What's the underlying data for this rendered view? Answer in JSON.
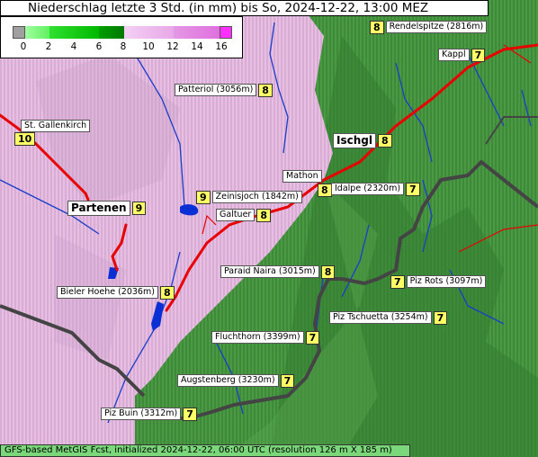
{
  "title": "Niederschlag letzte 3 Std. (in mm) bis So, 2024-12-22, 13:00 MEZ",
  "legend": {
    "ticks": [
      "0",
      "2",
      "4",
      "6",
      "8",
      "10",
      "12",
      "14",
      "16"
    ],
    "colors": [
      "#a0a0a0",
      "#80ff80",
      "#00e000",
      "#00b000",
      "#008000",
      "#f0c0f0",
      "#e8a0e8",
      "#e080e0",
      "#ff40ff"
    ]
  },
  "footer": "GFS-based MetGIS Fcst, initialized 2024-12-22, 06:00 UTC  (resolution 126 m X 185 m)",
  "places": [
    {
      "name": "Rendelspitze (2816m)",
      "value": "8",
      "order": "value-first"
    },
    {
      "name": "Kappl",
      "value": "7",
      "order": "name-first"
    },
    {
      "name": "Patteriol (3056m)",
      "value": "8",
      "order": "name-first"
    },
    {
      "name": "St. Gallenkirch",
      "value": "10",
      "order": "name-above"
    },
    {
      "name": "Ischgl",
      "value": "8",
      "order": "name-first",
      "big": true
    },
    {
      "name": "Mathon",
      "value": "8",
      "order": "name-above"
    },
    {
      "name": "Idalpe (2320m)",
      "value": "7",
      "order": "name-first"
    },
    {
      "name": "Zeinisjoch (1842m)",
      "value": "9",
      "order": "value-first"
    },
    {
      "name": "Partenen",
      "value": "9",
      "order": "name-first",
      "big": true
    },
    {
      "name": "Galtuer",
      "value": "8",
      "order": "name-first"
    },
    {
      "name": "Paraid Naira (3015m)",
      "value": "8",
      "order": "name-first"
    },
    {
      "name": "Piz Rots (3097m)",
      "value": "7",
      "order": "value-first"
    },
    {
      "name": "Bieler Hoehe (2036m)",
      "value": "8",
      "order": "name-first"
    },
    {
      "name": "Piz Tschuetta (3254m)",
      "value": "7",
      "order": "name-first"
    },
    {
      "name": "Fluchthorn (3399m)",
      "value": "7",
      "order": "name-first"
    },
    {
      "name": "Augstenberg (3230m)",
      "value": "7",
      "order": "name-first"
    },
    {
      "name": "Piz Buin (3312m)",
      "value": "7",
      "order": "name-first"
    }
  ]
}
